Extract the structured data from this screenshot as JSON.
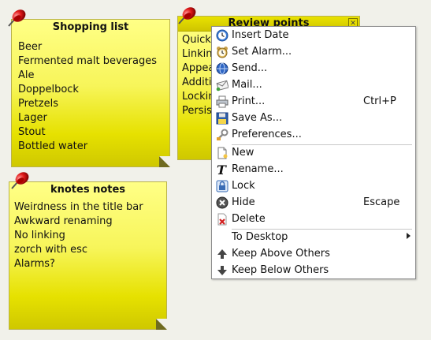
{
  "notes": {
    "shopping": {
      "title": "Shopping list",
      "items": [
        "Beer",
        "Fermented malt beverages",
        "Ale",
        "Doppelbock",
        "Pretzels",
        "Lager",
        "Stout",
        "Bottled water"
      ]
    },
    "review": {
      "title": "Review points",
      "items": [
        "Quick",
        "Linkin",
        "Appea",
        "Additi",
        "Lockin",
        "Persis"
      ]
    },
    "knotes": {
      "title": "knotes notes",
      "items": [
        "Weirdness in the title bar",
        "Awkward renaming",
        "No linking",
        "zorch with esc",
        "Alarms?"
      ]
    }
  },
  "menu": {
    "items": [
      {
        "label": "Insert Date",
        "shortcut": "",
        "icon": "clock-icon"
      },
      {
        "label": "Set Alarm...",
        "shortcut": "",
        "icon": "alarm-clock-icon"
      },
      {
        "label": "Send...",
        "shortcut": "",
        "icon": "network-send-icon"
      },
      {
        "label": "Mail...",
        "shortcut": "",
        "icon": "mail-icon"
      },
      {
        "label": "Print...",
        "shortcut": "Ctrl+P",
        "icon": "printer-icon"
      },
      {
        "label": "Save As...",
        "shortcut": "",
        "icon": "save-icon"
      },
      {
        "label": "Preferences...",
        "shortcut": "",
        "icon": "preferences-icon"
      },
      {
        "label": "New",
        "shortcut": "",
        "icon": "new-document-icon"
      },
      {
        "label": "Rename...",
        "shortcut": "",
        "icon": "rename-icon"
      },
      {
        "label": "Lock",
        "shortcut": "",
        "icon": "lock-icon"
      },
      {
        "label": "Hide",
        "shortcut": "Escape",
        "icon": "hide-icon"
      },
      {
        "label": "Delete",
        "shortcut": "",
        "icon": "delete-icon"
      },
      {
        "label": "To Desktop",
        "shortcut": "",
        "icon": ""
      },
      {
        "label": "Keep Above Others",
        "shortcut": "",
        "icon": "arrow-up-icon"
      },
      {
        "label": "Keep Below Others",
        "shortcut": "",
        "icon": "arrow-down-icon"
      }
    ]
  },
  "colors": {
    "note_yellow": "#f7f55a",
    "menu_background": "#ffffff"
  }
}
